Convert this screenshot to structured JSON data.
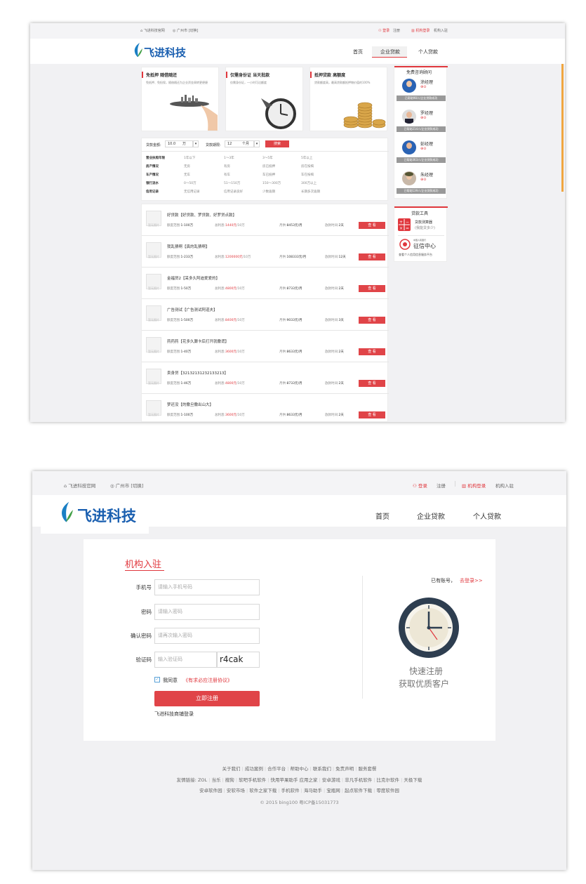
{
  "top": {
    "site_link": "飞进科技官网",
    "city": "广州市",
    "switch": "[切换]",
    "login": "登录",
    "register": "注册",
    "org_login": "机构登录",
    "org_join": "机构入驻"
  },
  "logo": {
    "text": "飞进科技"
  },
  "nav": [
    "首页",
    "企业贷款",
    "个人贷款"
  ],
  "features": [
    {
      "title": "免抵押  随借随还",
      "desc": "免抵押、免担保，随借随还为企业资金周转更便捷"
    },
    {
      "title": "仅需身份证  当天批款",
      "desc": "仅需身份证，一小时可达额度"
    },
    {
      "title": "抵押贷款  高额度",
      "desc": "贷款额度高，最高贷款额抵押物价值的100%"
    }
  ],
  "consult": {
    "title": "免费咨询顾问",
    "advisors": [
      {
        "name": "涂经理",
        "stat": "已帮助98人/企业贷款成功"
      },
      {
        "name": "罗经理",
        "stat": "已帮助214人/企业贷款成功"
      },
      {
        "name": "彭经理",
        "stat": "已帮助363人/企业贷款成功"
      },
      {
        "name": "朱经理",
        "stat": "已帮助139人/企业贷款成功"
      }
    ]
  },
  "tools": {
    "title": "贷款工具",
    "calc_title": "贷款测算器",
    "calc_sub": "(我能贷多少)",
    "credit_top": "中国人民银行",
    "credit_main": "征信中心",
    "credit_sub": "查看个人信用信息服务平台"
  },
  "filter": {
    "amount_label": "贷款金额:",
    "amount_value": "10.0",
    "amount_unit": "万",
    "term_label": "贷款期限:",
    "term_value": "12",
    "term_unit": "个月",
    "search": "搜索",
    "rows": [
      {
        "label": "营业执照年限",
        "opts": [
          "1年以下",
          "1～3年",
          "3～5年",
          "5年以上"
        ]
      },
      {
        "label": "房产情况",
        "opts": [
          "无房",
          "有房",
          "房已抵押",
          "房在按揭"
        ]
      },
      {
        "label": "车产情况",
        "opts": [
          "无车",
          "有车",
          "车已抵押",
          "车在按揭"
        ]
      },
      {
        "label": "银行流水",
        "opts": [
          "0～50万",
          "51～150万",
          "150～300万",
          "300万以上"
        ]
      },
      {
        "label": "信用记录",
        "opts": [
          "无信用记录",
          "信用记录良好",
          "少数逾期",
          "长期多次逾期"
        ]
      }
    ]
  },
  "loan_labels": {
    "range": "额度范围:",
    "total": "总利息:",
    "monthly": "月供:",
    "time": "放款时间:",
    "view": "查 看",
    "thumb": "暂无图片"
  },
  "loans": [
    {
      "name": "好贷款【好贷款、罗贷款、好罗贷点款】",
      "range": "1-100万",
      "total": "1440元",
      "per": "/10万",
      "monthly": "8453元/月",
      "time": "2天"
    },
    {
      "name": "我乱猜啊【真的乱猜啊】",
      "range": "1-233万",
      "total": "1200000元",
      "per": "/10万",
      "monthly": "108333元/月",
      "time": "12天"
    },
    {
      "name": "金福贷2【呆多久阿迪爱爱的】",
      "range": "1-50万",
      "total": "4800元",
      "per": "/10万",
      "monthly": "8733元/月",
      "time": "2天"
    },
    {
      "name": "广告测试【广告测试阿道夫】",
      "range": "1-500万",
      "total": "8400元",
      "per": "/10万",
      "monthly": "9033元/月",
      "time": "3天"
    },
    {
      "name": "药药药【花多久厮卡后打开就撒谎】",
      "range": "1-40万",
      "total": "3600元",
      "per": "/10万",
      "monthly": "8633元/月",
      "time": "2天"
    },
    {
      "name": "卖身贷【32132131232133213】",
      "range": "1-46万",
      "total": "4800元",
      "per": "/10万",
      "monthly": "8733元/月",
      "time": "2天"
    },
    {
      "name": "梦还没【的撒旦撒出山大】",
      "range": "1-100万",
      "total": "3600元",
      "per": "/10万",
      "monthly": "8633元/月",
      "time": "2天"
    }
  ],
  "register": {
    "title": "机构入驻",
    "phone_label": "手机号",
    "phone_ph": "请输入手机号码",
    "pwd_label": "密码",
    "pwd_ph": "请输入密码",
    "pwd2_label": "确认密码",
    "pwd2_ph": "请再次输入密码",
    "code_label": "验证码",
    "code_ph": "输入验证码",
    "captcha": "r4cak",
    "agree": "我同意",
    "agreement": "《有求必应注册协议》",
    "submit": "立即注册",
    "merchant_login": "飞进科技商铺登录",
    "has_account": "已有账号，",
    "go_login": "去登录>>",
    "slogan1": "快速注册",
    "slogan2": "获取优质客户"
  },
  "footer": {
    "links": [
      "关于我们",
      "成功案例",
      "合作平台",
      "帮助中心",
      "联系我们",
      "免责声明",
      "服务套餐"
    ],
    "friend_label": "友情链接:",
    "friends1": [
      "ZOL",
      "当乐",
      "搜狗",
      "软吧手机软件",
      "快用苹果助手 应用之家",
      "安卓游戏",
      "非凡手机软件",
      "比克尔软件",
      "天极下载"
    ],
    "friends2": [
      "安卓软件园",
      "安软市场",
      "软件之家下载",
      "手机软件",
      "海马助手",
      "宝瓶网",
      "起点软件下载",
      "零度软件园"
    ],
    "copyright": "© 2015 bing100 粤ICP备15031773"
  }
}
